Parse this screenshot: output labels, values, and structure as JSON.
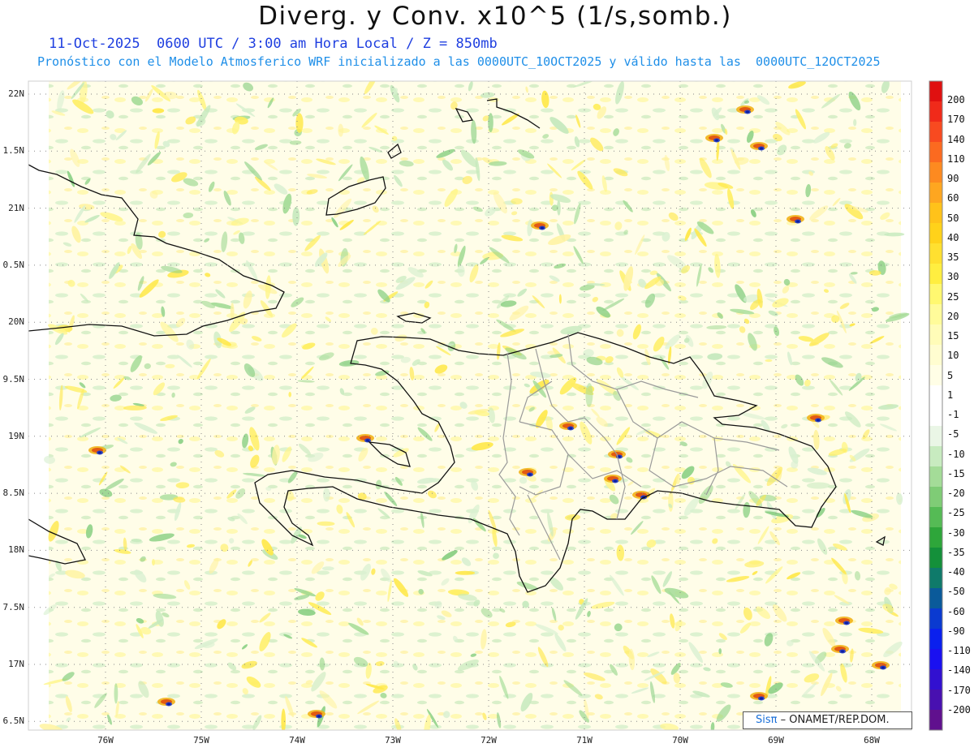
{
  "header": {
    "title": "Diverg. y Conv. x10^5 (1/s,somb.)",
    "line1": "11-Oct-2025  0600 UTC / 3:00 am Hora Local / Z = 850mb",
    "line2": "Pronóstico con el Modelo Atmosferico WRF inicializado a las 0000UTC_10OCT2025 y válido hasta las  0000UTC_12OCT2025"
  },
  "lat_labels": [
    "22N",
    "1.5N",
    "21N",
    "0.5N",
    "20N",
    "9.5N",
    "19N",
    "8.5N",
    "18N",
    "7.5N",
    "17N",
    "6.5N"
  ],
  "lon_labels": [
    "76W",
    "75W",
    "74W",
    "73W",
    "72W",
    "71W",
    "70W",
    "69W",
    "68W"
  ],
  "colorbar": {
    "labels": [
      "200",
      "170",
      "140",
      "110",
      "90",
      "60",
      "50",
      "40",
      "35",
      "30",
      "25",
      "20",
      "15",
      "10",
      "5",
      "1",
      "-1",
      "-5",
      "-10",
      "-15",
      "-20",
      "-25",
      "-30",
      "-35",
      "-40",
      "-50",
      "-60",
      "-90",
      "-110",
      "-140",
      "-170",
      "-200"
    ],
    "colors": [
      "#e01010",
      "#f02a1a",
      "#f84a20",
      "#fb6a20",
      "#fd8a20",
      "#fea620",
      "#ffc21a",
      "#ffd21a",
      "#ffe030",
      "#ffee40",
      "#fff870",
      "#fffb9a",
      "#fffcb8",
      "#fffdd0",
      "#fffee6",
      "#ffffff",
      "#ffffff",
      "#eaf6e6",
      "#c8ebc0",
      "#a4dc98",
      "#7fcc76",
      "#55bb55",
      "#2ea63a",
      "#14903a",
      "#0f7a6a",
      "#0a5a9a",
      "#0a3ad0",
      "#0a20ee",
      "#1a10f0",
      "#3210d0",
      "#4810b0",
      "#60108e"
    ]
  },
  "credit": {
    "brand": "Sisπ",
    "org": "– ONAMET/REP.DOM."
  }
}
